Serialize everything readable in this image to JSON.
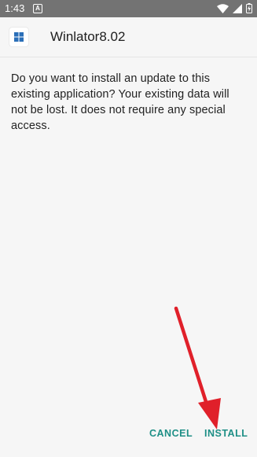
{
  "status_bar": {
    "time": "1:43",
    "notification_icon": "android-notification-icon",
    "wifi_icon": "wifi-icon",
    "signal_icon": "cell-signal-icon",
    "battery_icon": "battery-icon"
  },
  "dialog": {
    "app_name": "Winlator8.02",
    "app_icon": "winlator-icon",
    "message": "Do you want to install an update to this existing application? Your existing data will not be lost. It does not require any special access.",
    "cancel_label": "CANCEL",
    "install_label": "INSTALL"
  },
  "annotation": {
    "arrow_color": "#e0202a"
  },
  "colors": {
    "accent": "#1e8f86",
    "status_bar": "#737373",
    "background": "#f6f6f6"
  }
}
